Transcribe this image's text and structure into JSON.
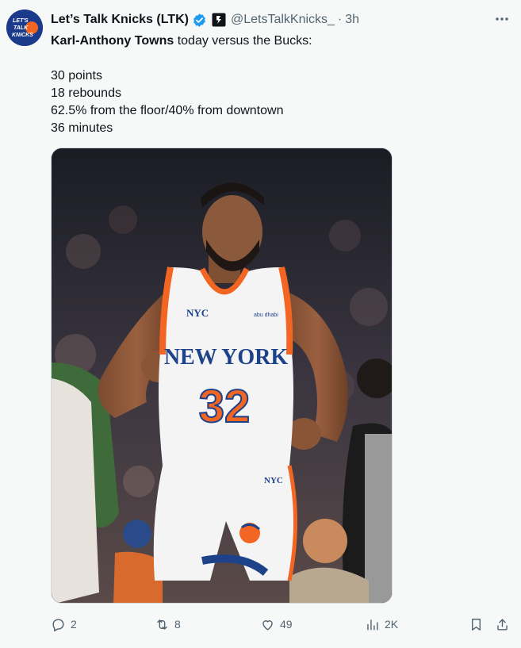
{
  "author": {
    "display_name": "Let’s Talk Knicks (LTK)",
    "handle": "@LetsTalkKnicks_",
    "separator": "·",
    "time": "3h",
    "avatar_text": [
      "LET'S",
      "TALK",
      "KNICKS"
    ]
  },
  "tweet": {
    "mention": "Karl-Anthony Towns",
    "intro_rest": " today versus the Bucks:",
    "stats": [
      "30 points",
      "18 rebounds",
      "62.5% from the floor/40% from downtown",
      "36 minutes"
    ]
  },
  "media": {
    "jersey_city": "NYC",
    "jersey_team": "NEW YORK",
    "jersey_number": "32",
    "jersey_sponsor": "abu dhabi",
    "shorts_city": "NYC"
  },
  "actions": {
    "replies": "2",
    "reposts": "8",
    "likes": "49",
    "views": "2K"
  },
  "colors": {
    "verified": "#1d9bf0",
    "knicks_orange": "#f26522",
    "knicks_blue": "#1d428a"
  }
}
